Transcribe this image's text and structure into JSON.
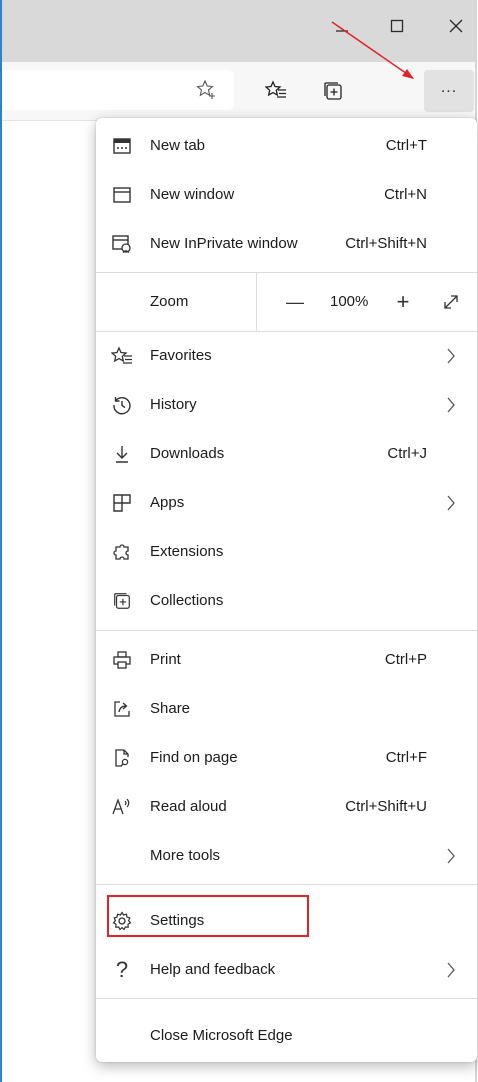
{
  "window": {
    "minimize_icon": "minimize-icon",
    "maximize_icon": "maximize-icon",
    "close_icon": "close-icon"
  },
  "toolbar": {
    "favorite_icon": "add-favorite-star-icon",
    "favorites_icon": "favorites-icon",
    "collections_icon": "collections-icon",
    "more_label": "..."
  },
  "menu": {
    "new_tab": {
      "label": "New tab",
      "shortcut": "Ctrl+T"
    },
    "new_window": {
      "label": "New window",
      "shortcut": "Ctrl+N"
    },
    "new_inprivate": {
      "label": "New InPrivate window",
      "shortcut": "Ctrl+Shift+N"
    },
    "zoom": {
      "label": "Zoom",
      "value": "100%",
      "minus": "—",
      "plus": "+"
    },
    "favorites": {
      "label": "Favorites"
    },
    "history": {
      "label": "History"
    },
    "downloads": {
      "label": "Downloads",
      "shortcut": "Ctrl+J"
    },
    "apps": {
      "label": "Apps"
    },
    "extensions": {
      "label": "Extensions"
    },
    "collections": {
      "label": "Collections"
    },
    "print": {
      "label": "Print",
      "shortcut": "Ctrl+P"
    },
    "share": {
      "label": "Share"
    },
    "find_on_page": {
      "label": "Find on page",
      "shortcut": "Ctrl+F"
    },
    "read_aloud": {
      "label": "Read aloud",
      "shortcut": "Ctrl+Shift+U"
    },
    "more_tools": {
      "label": "More tools"
    },
    "settings": {
      "label": "Settings"
    },
    "help": {
      "label": "Help and feedback"
    },
    "close_edge": {
      "label": "Close Microsoft Edge"
    }
  },
  "colors": {
    "annotation_red": "#e0232b",
    "titlebar": "#d9d9d9",
    "window_accent": "#2a84c8"
  }
}
